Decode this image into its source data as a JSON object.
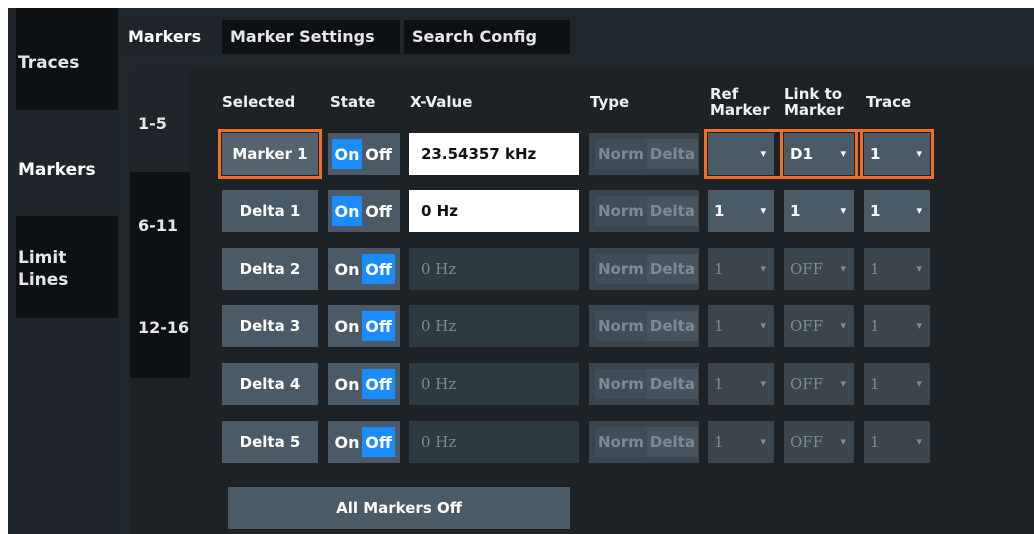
{
  "left_tabs": [
    {
      "label": "Traces",
      "active": false
    },
    {
      "label": "Markers",
      "active": true
    },
    {
      "label_line1": "Limit",
      "label_line2": "Lines",
      "active": false
    }
  ],
  "top_tabs": [
    {
      "label": "Markers",
      "active": true
    },
    {
      "label": "Marker Settings",
      "active": false
    },
    {
      "label": "Search Config",
      "active": false
    }
  ],
  "range_tabs": [
    {
      "label": "1-5",
      "active": true
    },
    {
      "label": "6-11",
      "active": false
    },
    {
      "label": "12-16",
      "active": false
    }
  ],
  "columns": {
    "selected": "Selected",
    "state": "State",
    "x_value": "X-Value",
    "type": "Type",
    "ref_marker_1": "Ref",
    "ref_marker_2": "Marker",
    "link_1": "Link to",
    "link_2": "Marker",
    "trace": "Trace"
  },
  "toggle_labels": {
    "on": "On",
    "off": "Off"
  },
  "type_labels": {
    "norm": "Norm",
    "delta": "Delta"
  },
  "rows": [
    {
      "name": "Marker 1",
      "state": "on",
      "x_value": "23.54357 kHz",
      "ref": "",
      "link": "D1",
      "trace": "1",
      "highlight": true
    },
    {
      "name": "Delta 1",
      "state": "on",
      "x_value": "0 Hz",
      "ref": "1",
      "link": "1",
      "trace": "1",
      "highlight": false
    },
    {
      "name": "Delta 2",
      "state": "off",
      "x_value": "0 Hz",
      "ref": "1",
      "link": "OFF",
      "trace": "1",
      "highlight": false
    },
    {
      "name": "Delta 3",
      "state": "off",
      "x_value": "0 Hz",
      "ref": "1",
      "link": "OFF",
      "trace": "1",
      "highlight": false
    },
    {
      "name": "Delta 4",
      "state": "off",
      "x_value": "0 Hz",
      "ref": "1",
      "link": "OFF",
      "trace": "1",
      "highlight": false
    },
    {
      "name": "Delta 5",
      "state": "off",
      "x_value": "0 Hz",
      "ref": "1",
      "link": "OFF",
      "trace": "1",
      "highlight": false
    }
  ],
  "all_markers_off": "All Markers Off",
  "colors": {
    "accent_on": "#1a8cff",
    "highlight": "#f26f21",
    "background": "#20272c"
  }
}
